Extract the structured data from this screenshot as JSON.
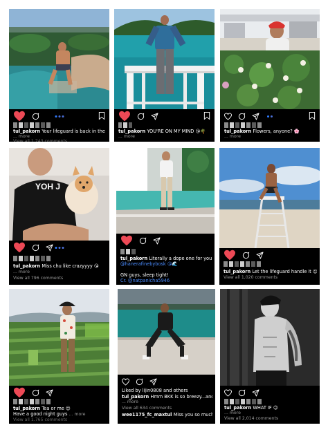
{
  "accent_color": "#ed4956",
  "link_color": "#4a8cff",
  "icons": {
    "like": "heart-icon",
    "liked": "heart-filled-icon",
    "comment": "comment-icon",
    "share": "send-icon",
    "save": "bookmark-icon"
  },
  "posts": [
    {
      "caption_user": "tul_pakorn",
      "caption_text": "Your lifeguard is back in the office",
      "emoji": "☀️🏄",
      "more": "... more",
      "comments": "View all 1,743 comments"
    },
    {
      "caption_user": "tul_pakorn",
      "caption_text": "YOU'RE ON MY MIND",
      "emoji": "😘🌴",
      "more": "... more"
    },
    {
      "caption_user": "tul_pakorn",
      "caption_text": "Flowers, anyone?",
      "emoji": "🌸",
      "more": "... more"
    },
    {
      "caption_user": "tul_pakorn",
      "caption_text": "Miss chu like crazyyyy",
      "emoji": "😘",
      "more": "... more",
      "comments": "View all 796 comments"
    },
    {
      "caption_user": "tul_pakorn",
      "caption_text": "Literally a dope one for your vacay",
      "line2": "@hanerafinebybosk 😘🌊",
      "line3": "",
      "line4": "GN guys, sleep tight!",
      "line5": "Cr. @natpanicha5946"
    },
    {
      "caption_user": "tul_pakorn",
      "caption_text": "Let the lifeguard handle it",
      "emoji": "😉😊",
      "more": "... more",
      "comments": "View all 1,020 comments"
    },
    {
      "caption_user": "tul_pakorn",
      "caption_text": "Tea or me",
      "emoji": "😊",
      "line2": "Have a good night guys",
      "more": "... more",
      "comments": "View all 1,765 comments"
    },
    {
      "liked_by": "Liked by lijin0808 and others",
      "caption_user": "tul_pakorn",
      "caption_text": "Hmm BKK is so breezy...and a bit hot",
      "more": "... more",
      "comments": "View all 634 comments",
      "reply_user": "wee1175_fc_maxtul",
      "reply_text": "Miss you so much /GN"
    },
    {
      "caption_user": "tul_pakorn",
      "caption_text": "WHAT IF",
      "emoji": "😉",
      "more": "... more",
      "comments": "View all 2,014 comments"
    }
  ]
}
